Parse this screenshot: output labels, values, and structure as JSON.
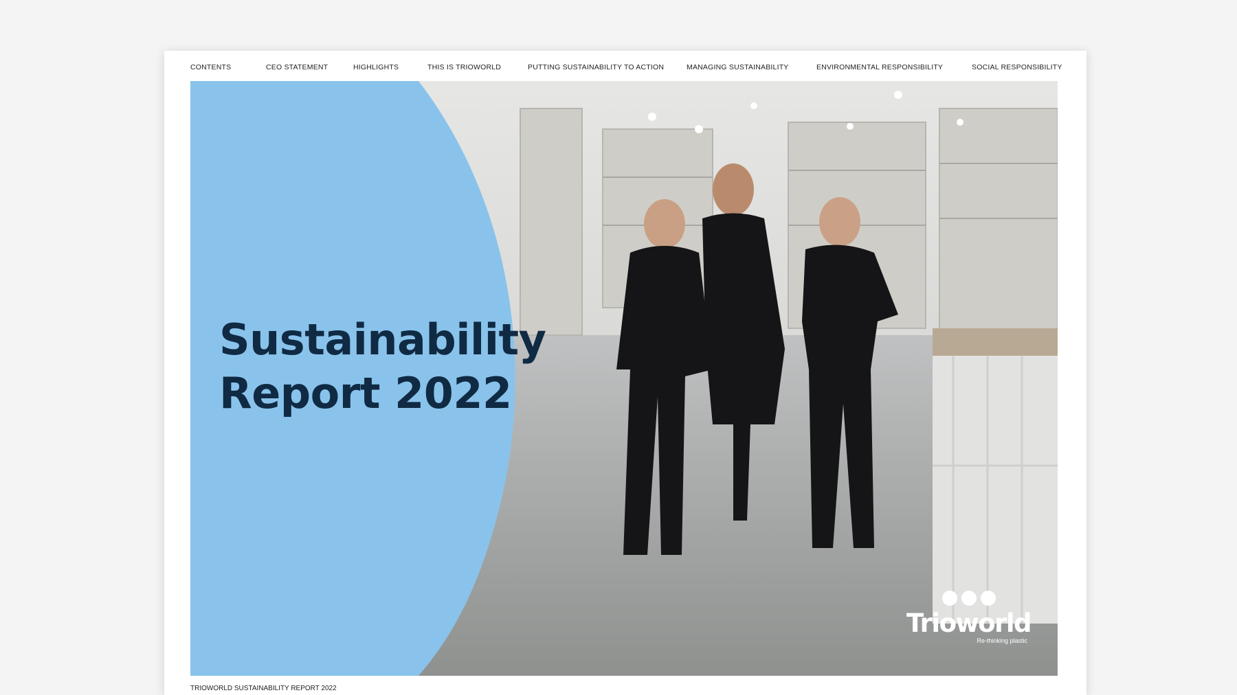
{
  "nav": {
    "items": [
      {
        "label": "CONTENTS"
      },
      {
        "label": "CEO STATEMENT"
      },
      {
        "label": "HIGHLIGHTS"
      },
      {
        "label": "THIS IS TRIOWORLD"
      },
      {
        "label": "PUTTING SUSTAINABILITY TO ACTION"
      },
      {
        "label": "MANAGING SUSTAINABILITY"
      },
      {
        "label": "ENVIRONMENTAL RESPONSIBILITY"
      },
      {
        "label": "SOCIAL RESPONSIBILITY"
      }
    ]
  },
  "cover": {
    "title_line1": "Sustainability",
    "title_line2": "Report 2022",
    "photo_icon": "warehouse-workers-photo",
    "colors": {
      "panel": "#89c3eb",
      "title": "#102a43"
    }
  },
  "logo": {
    "word": "Trioworld",
    "tagline": "Re-thinking plastic"
  },
  "footer": {
    "text": "TRIOWORLD SUSTAINABILITY REPORT 2022"
  }
}
